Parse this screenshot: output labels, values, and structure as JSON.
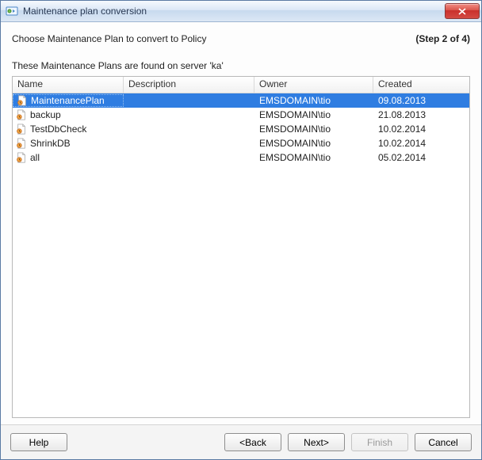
{
  "window": {
    "title": "Maintenance plan conversion"
  },
  "header": {
    "instruction": "Choose Maintenance Plan to convert to Policy",
    "step": "(Step 2 of 4)"
  },
  "subtitle": "These Maintenance Plans are found on server 'ka'",
  "columns": {
    "name": "Name",
    "description": "Description",
    "owner": "Owner",
    "created": "Created"
  },
  "rows": [
    {
      "name": "MaintenancePlan",
      "description": "",
      "owner": "EMSDOMAIN\\tio",
      "created": "09.08.2013",
      "selected": true
    },
    {
      "name": "backup",
      "description": "",
      "owner": "EMSDOMAIN\\tio",
      "created": "21.08.2013",
      "selected": false
    },
    {
      "name": "TestDbCheck",
      "description": "",
      "owner": "EMSDOMAIN\\tio",
      "created": "10.02.2014",
      "selected": false
    },
    {
      "name": "ShrinkDB",
      "description": "",
      "owner": "EMSDOMAIN\\tio",
      "created": "10.02.2014",
      "selected": false
    },
    {
      "name": "all",
      "description": "",
      "owner": "EMSDOMAIN\\tio",
      "created": "05.02.2014",
      "selected": false
    }
  ],
  "buttons": {
    "help": "Help",
    "back": "<Back",
    "next": "Next>",
    "finish": "Finish",
    "cancel": "Cancel"
  }
}
